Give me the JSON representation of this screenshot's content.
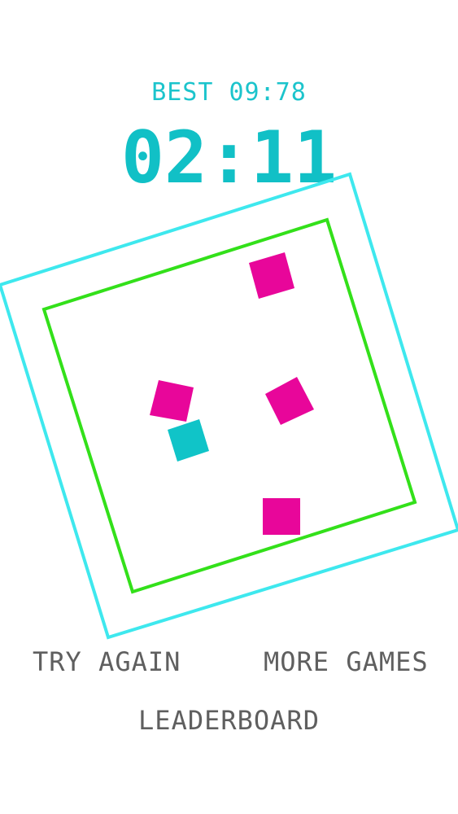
{
  "hud": {
    "best_label": "BEST 09:78",
    "timer": "02:11"
  },
  "board": {
    "outer_frame_color": "#3ee8ee",
    "inner_frame_color": "#33e01a",
    "enemy_color": "#e8069a",
    "player_color": "#10c4c8"
  },
  "menu": {
    "try_again": "TRY AGAIN",
    "more_games": "MORE GAMES",
    "leaderboard": "LEADERBOARD"
  }
}
